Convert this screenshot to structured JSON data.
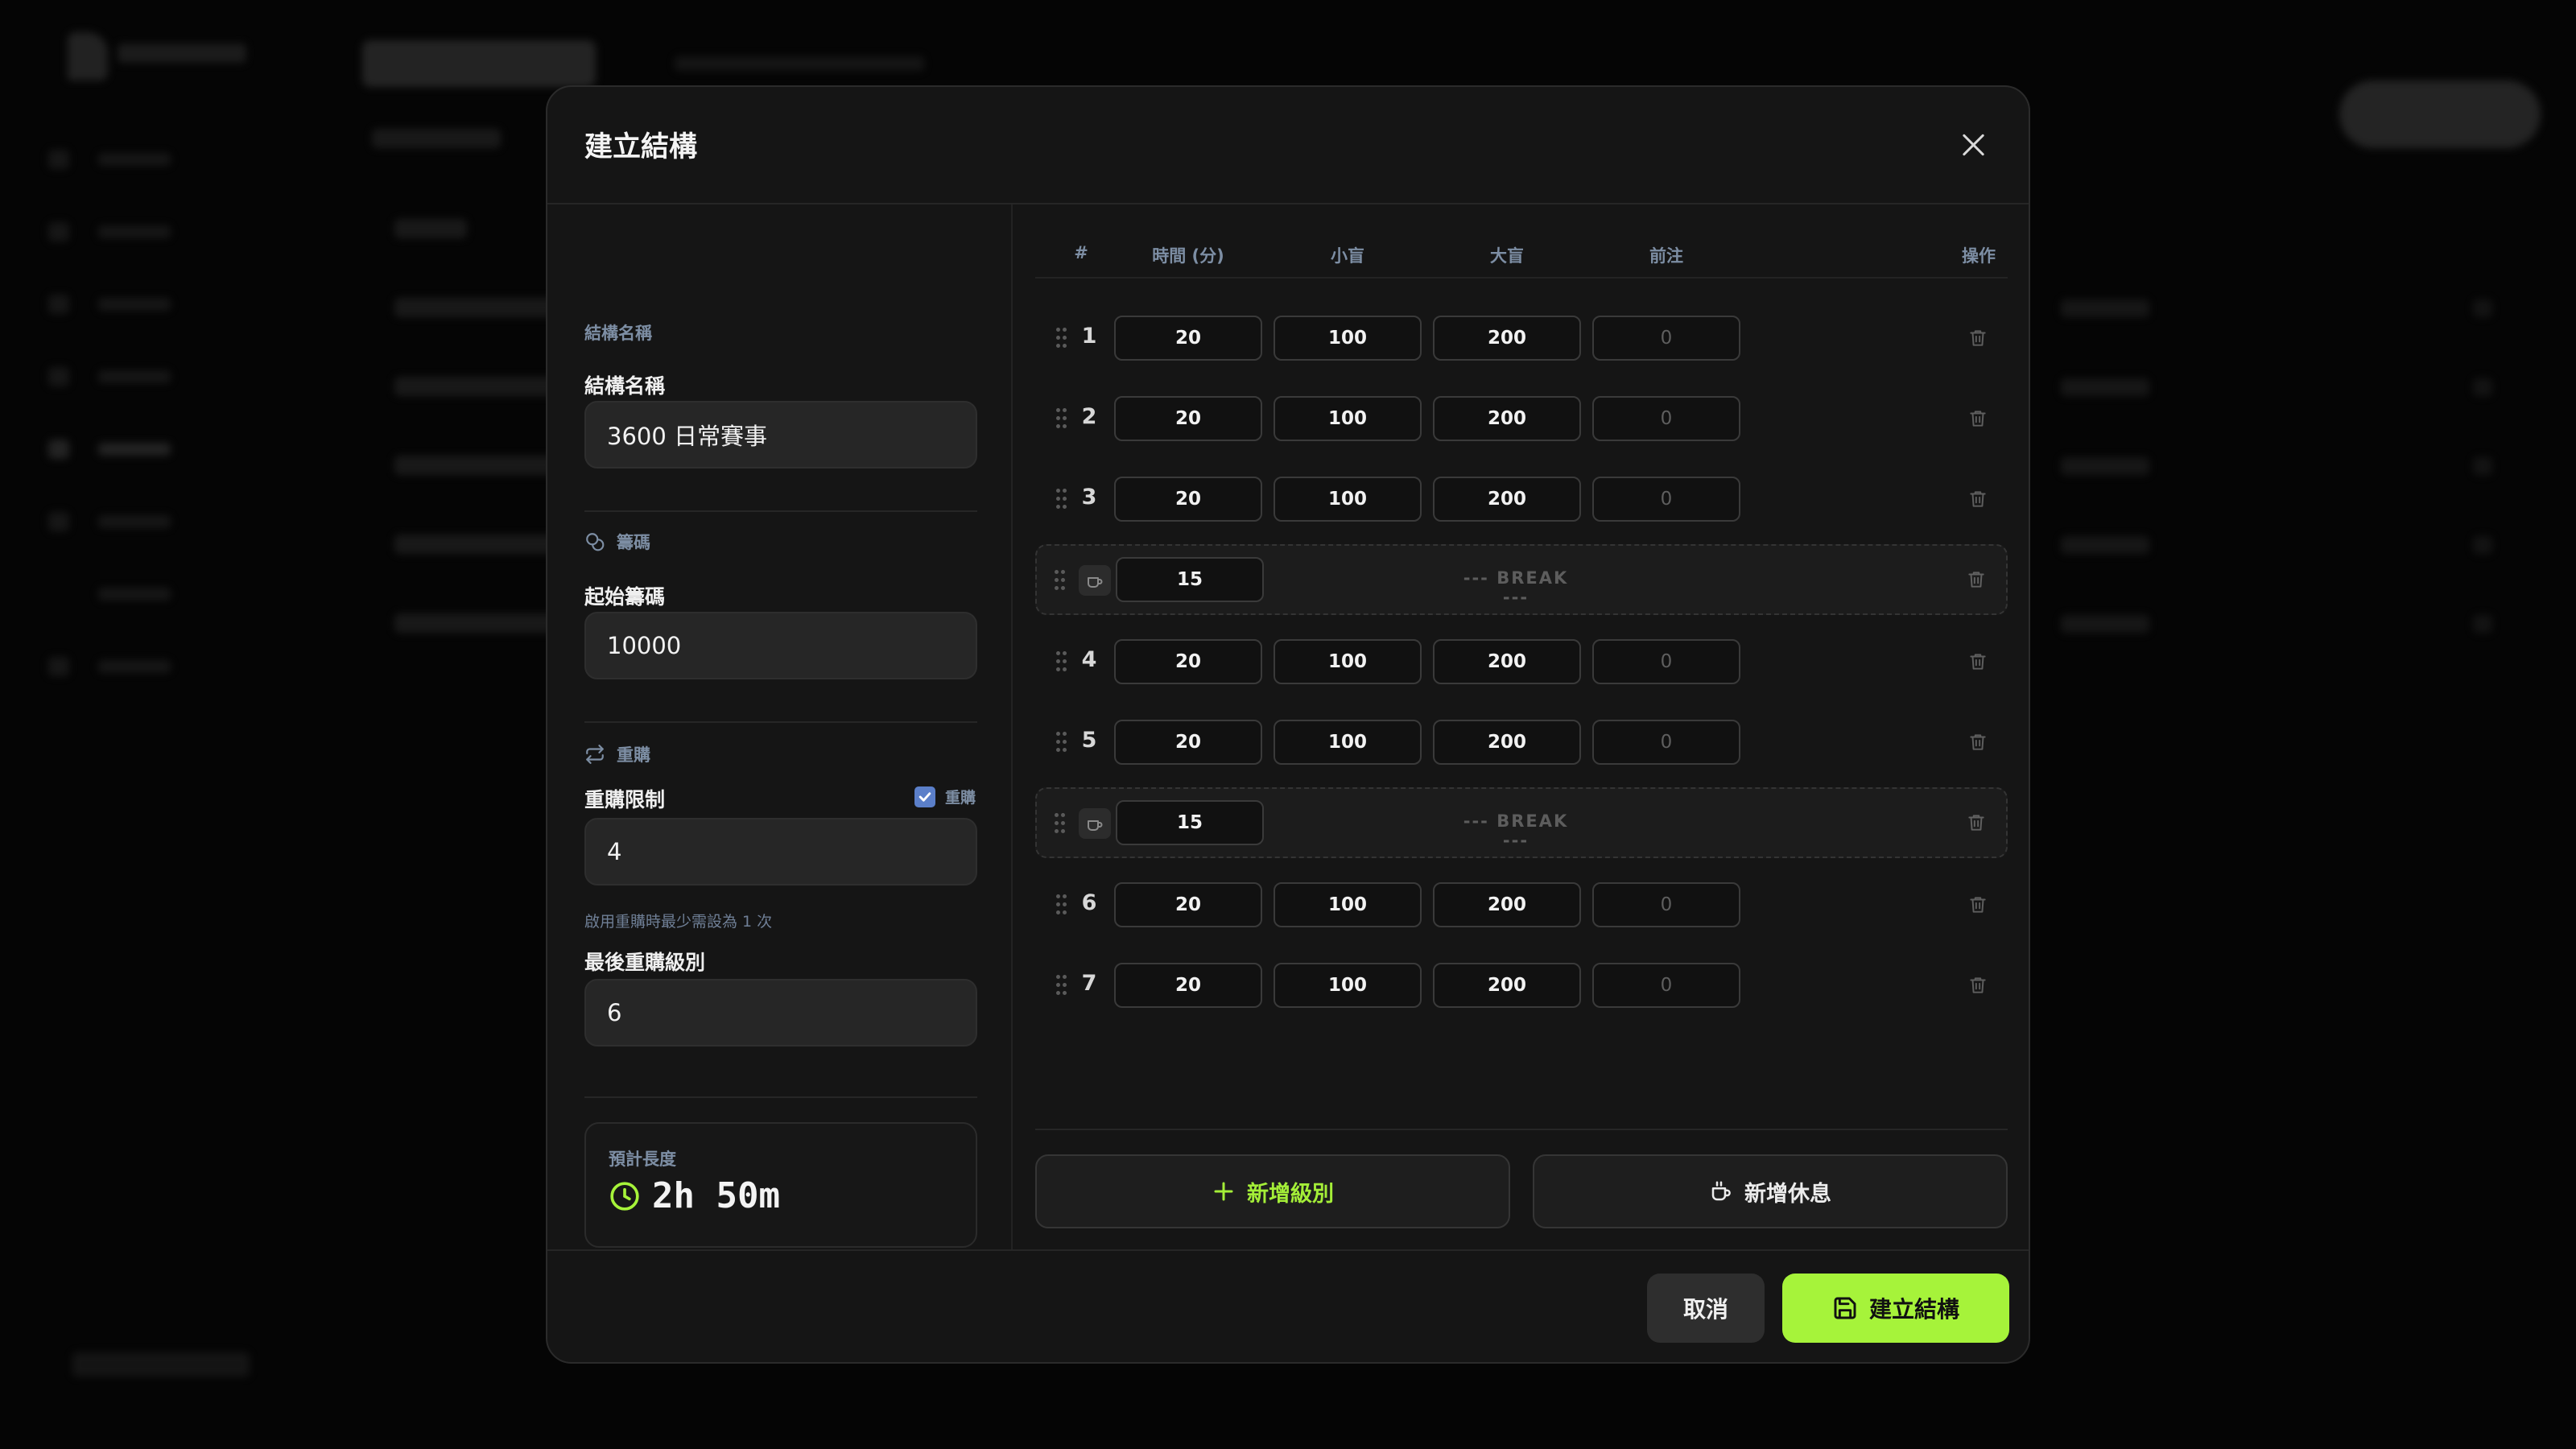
{
  "modal": {
    "title": "建立結構",
    "left": {
      "section_name_label": "結構名稱",
      "name_label": "結構名稱",
      "name_value": "3600 日常賽事",
      "chips_section_label": "籌碼",
      "starting_chips_label": "起始籌碼",
      "starting_chips_value": "10000",
      "rebuy_section_label": "重購",
      "rebuy_limit_label": "重購限制",
      "rebuy_checkbox_label": "重購",
      "rebuy_enabled": true,
      "rebuy_limit_value": "4",
      "rebuy_hint": "啟用重購時最少需設為 1 次",
      "last_rebuy_level_label": "最後重購級別",
      "last_rebuy_level_value": "6",
      "estimate_label": "預計長度",
      "estimate_value": "2h 50m"
    },
    "table": {
      "headers": [
        "#",
        "時間 (分)",
        "小盲",
        "大盲",
        "前注",
        "操作"
      ],
      "break_text": "--- BREAK ---",
      "rows": [
        {
          "type": "level",
          "num": "1",
          "time": "20",
          "sb": "100",
          "bb": "200",
          "ante": "0"
        },
        {
          "type": "level",
          "num": "2",
          "time": "20",
          "sb": "100",
          "bb": "200",
          "ante": "0"
        },
        {
          "type": "level",
          "num": "3",
          "time": "20",
          "sb": "100",
          "bb": "200",
          "ante": "0"
        },
        {
          "type": "break",
          "time": "15"
        },
        {
          "type": "level",
          "num": "4",
          "time": "20",
          "sb": "100",
          "bb": "200",
          "ante": "0"
        },
        {
          "type": "level",
          "num": "5",
          "time": "20",
          "sb": "100",
          "bb": "200",
          "ante": "0"
        },
        {
          "type": "break",
          "time": "15"
        },
        {
          "type": "level",
          "num": "6",
          "time": "20",
          "sb": "100",
          "bb": "200",
          "ante": "0"
        },
        {
          "type": "level",
          "num": "7",
          "time": "20",
          "sb": "100",
          "bb": "200",
          "ante": "0"
        }
      ]
    },
    "buttons": {
      "add_level": "新增級別",
      "add_break": "新增休息",
      "cancel": "取消",
      "create": "建立結構"
    }
  },
  "colors": {
    "accent": "#a6f33a",
    "muted_label": "#7d8ea4",
    "modal_bg": "#151515"
  }
}
